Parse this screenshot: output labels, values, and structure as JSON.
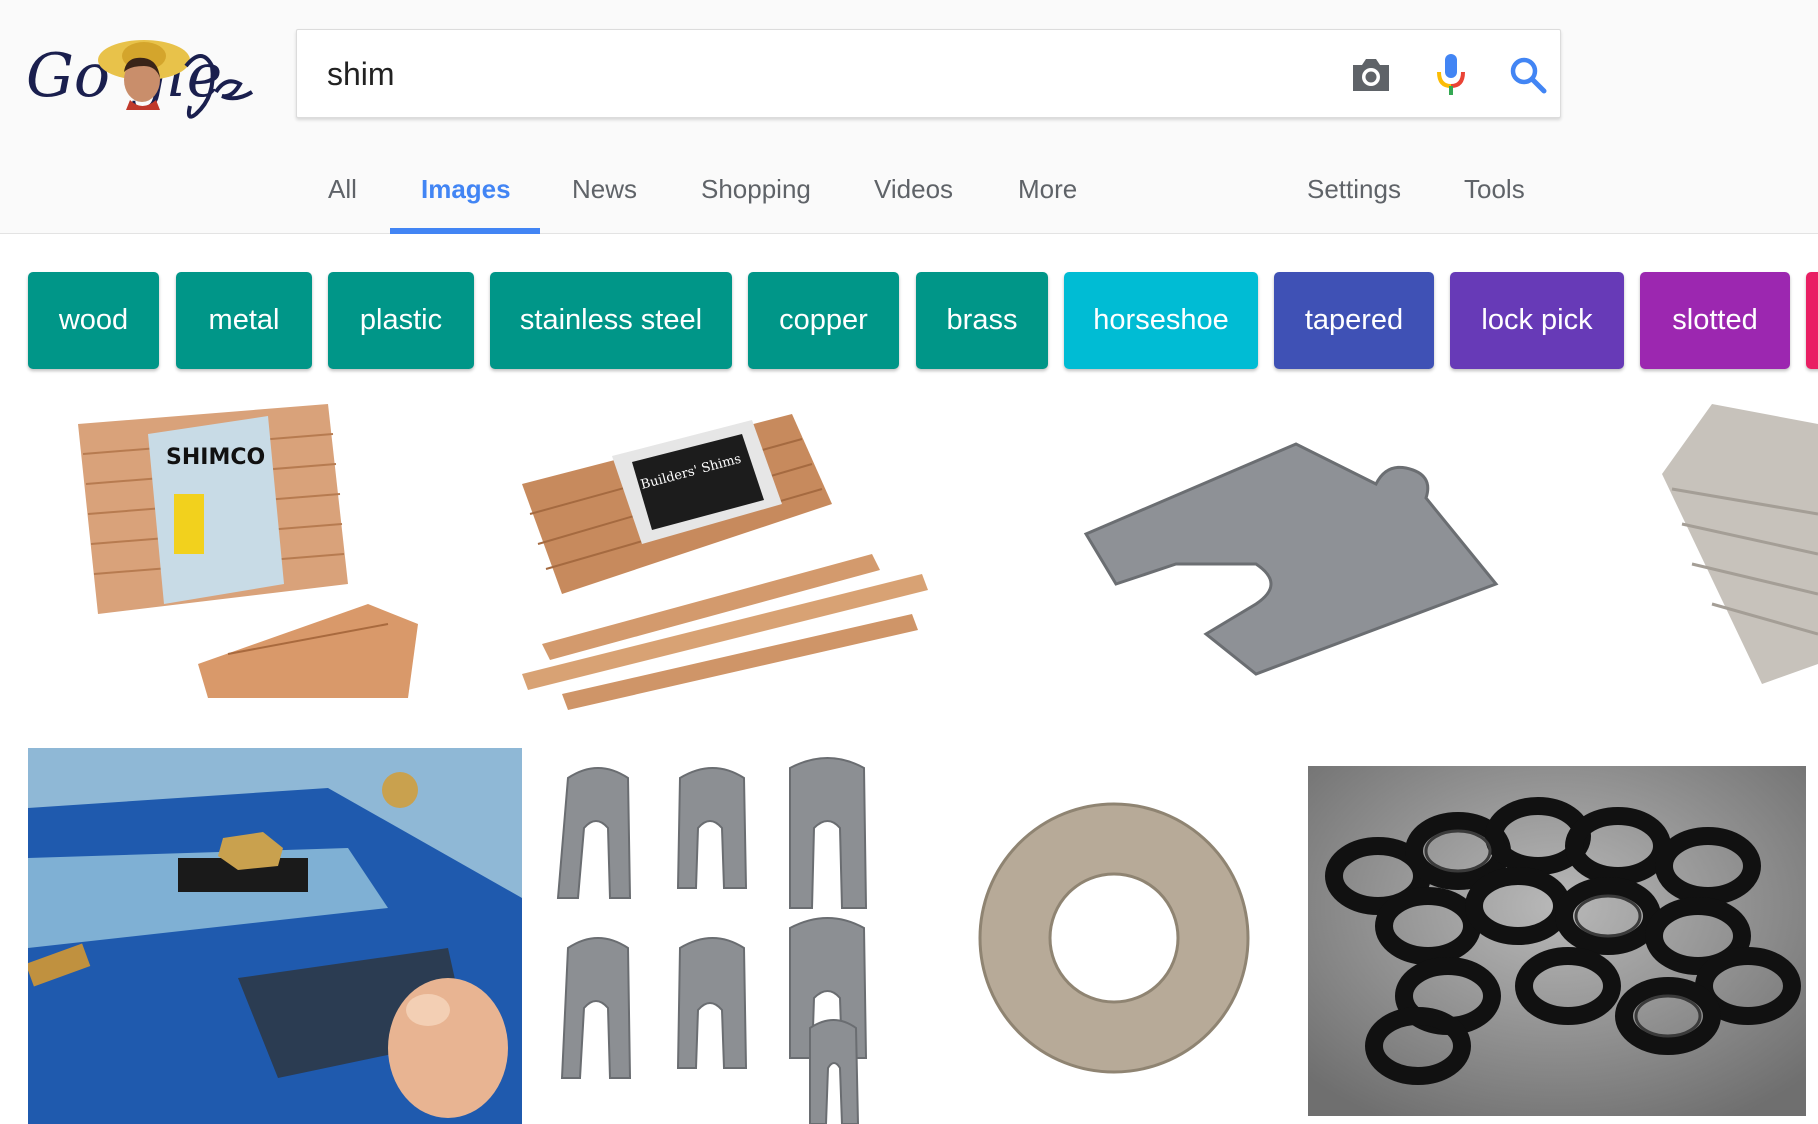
{
  "logo": {
    "text": "Go  gle"
  },
  "search": {
    "query": "shim",
    "camera_icon": "camera-icon",
    "mic_icon": "microphone-icon",
    "search_icon": "search-icon"
  },
  "tabs": [
    {
      "label": "All",
      "active": false
    },
    {
      "label": "Images",
      "active": true
    },
    {
      "label": "News",
      "active": false
    },
    {
      "label": "Shopping",
      "active": false
    },
    {
      "label": "Videos",
      "active": false
    },
    {
      "label": "More",
      "active": false
    }
  ],
  "tools": {
    "settings": "Settings",
    "tools": "Tools"
  },
  "chips": [
    {
      "label": "wood",
      "color": "#009688"
    },
    {
      "label": "metal",
      "color": "#009688"
    },
    {
      "label": "plastic",
      "color": "#009688"
    },
    {
      "label": "stainless steel",
      "color": "#009688"
    },
    {
      "label": "copper",
      "color": "#009688"
    },
    {
      "label": "brass",
      "color": "#009688"
    },
    {
      "label": "horseshoe",
      "color": "#00bcd4"
    },
    {
      "label": "tapered",
      "color": "#3f51b5"
    },
    {
      "label": "lock pick",
      "color": "#673ab7"
    },
    {
      "label": "slotted",
      "color": "#9c27b0"
    }
  ],
  "images": {
    "shimco_package_label": "SHIMCO",
    "builders_shims_label": "Builders' Shims"
  },
  "colors": {
    "accent": "#4285f4",
    "text_gray": "#5f6368"
  }
}
